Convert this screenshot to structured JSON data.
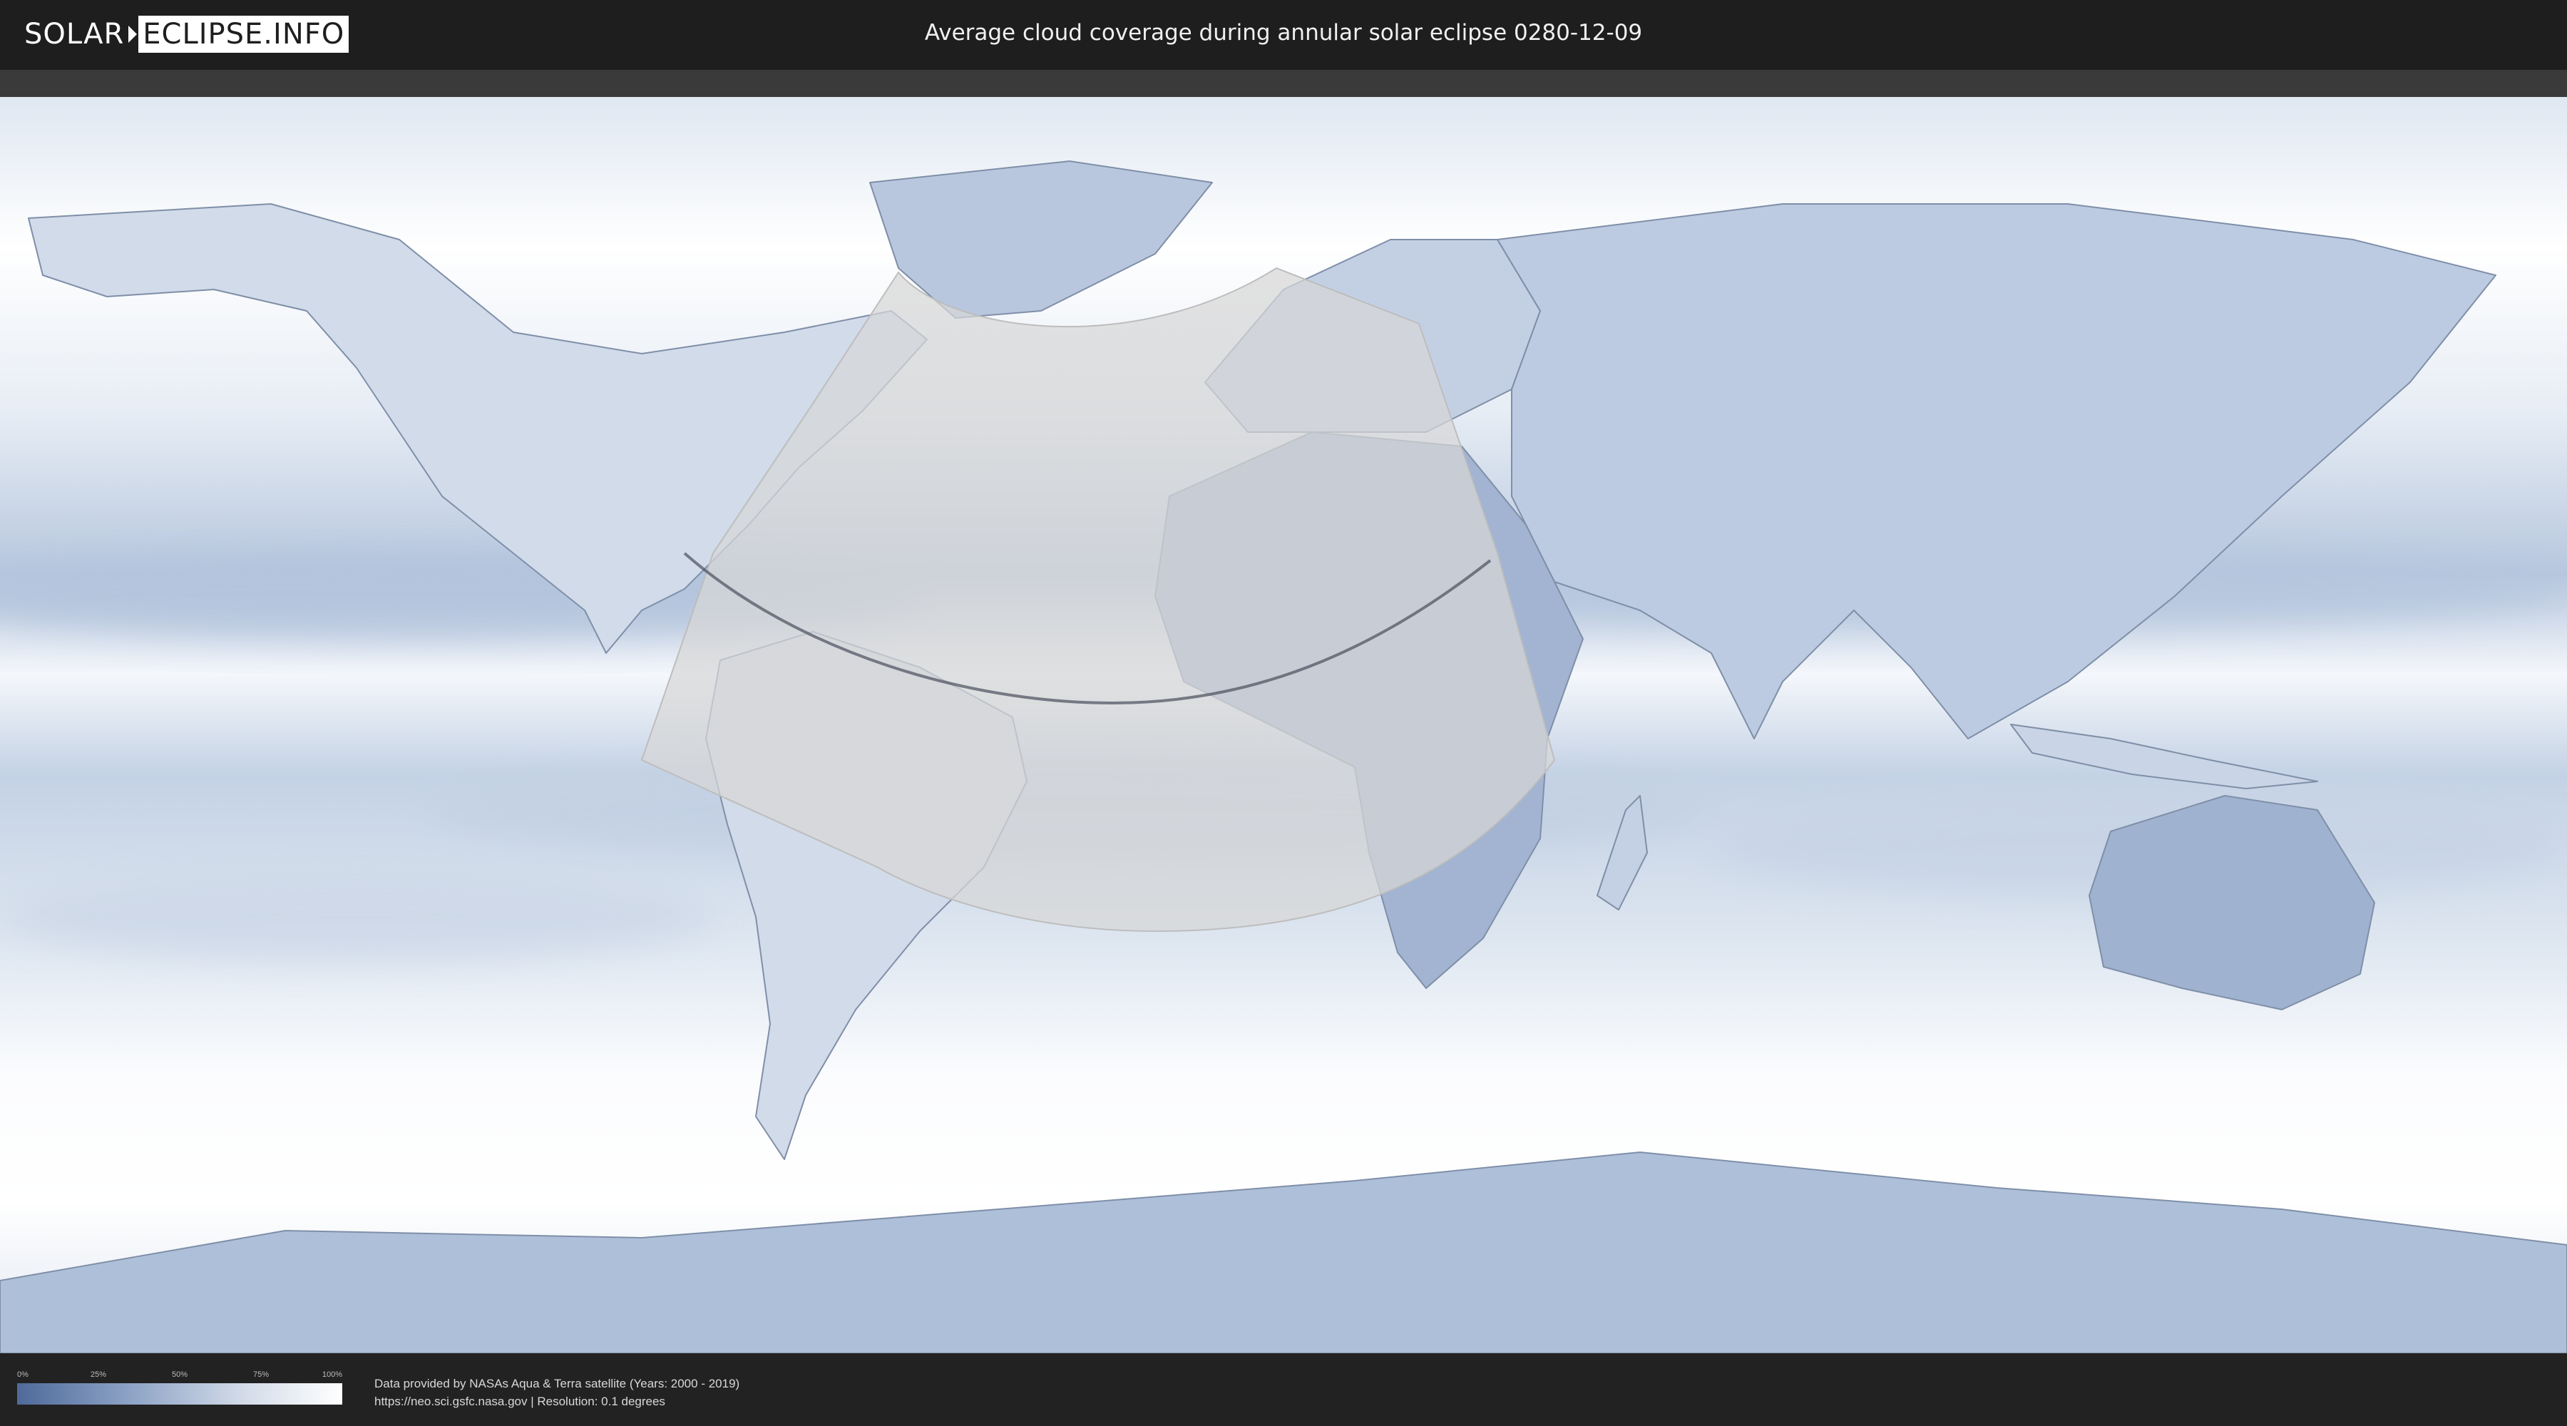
{
  "header": {
    "logo_left": "SOLAR",
    "logo_right": "ECLIPSE.INFO",
    "title": "Average cloud coverage during annular solar eclipse 0280-12-09"
  },
  "legend": {
    "ticks": [
      "0%",
      "25%",
      "50%",
      "75%",
      "100%"
    ],
    "colors": {
      "low": "#4f6a9a",
      "high": "#ffffff"
    }
  },
  "footer": {
    "credit_line1": "Data provided by NASAs Aqua & Terra satellite (Years: 2000 - 2019)",
    "credit_line2": "https://neo.sci.gsfc.nasa.gov | Resolution: 0.1 degrees"
  },
  "map": {
    "projection": "equirectangular",
    "ocean_color": "#e3eaf3",
    "cloud_low_color": "#5b76a6",
    "eclipse_zone_color": "#d7d7d7",
    "central_path_color": "#4a4f5c"
  }
}
